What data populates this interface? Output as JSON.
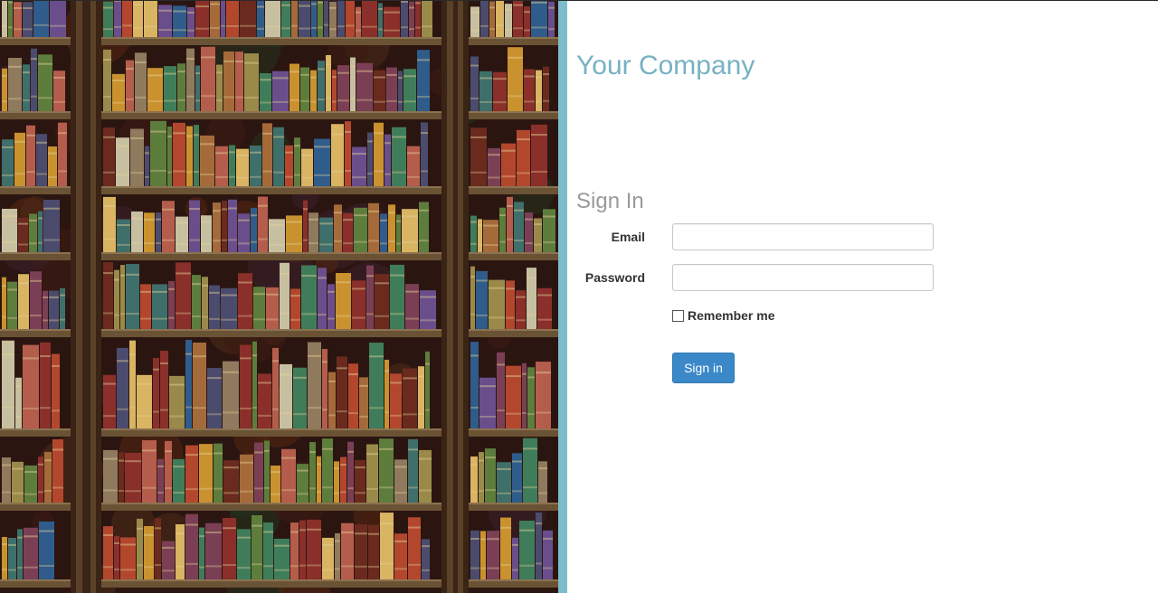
{
  "brand": {
    "company_name": "Your Company"
  },
  "signin": {
    "title": "Sign In",
    "email_label": "Email",
    "email_value": "",
    "password_label": "Password",
    "password_value": "",
    "remember_label": "Remember me",
    "remember_checked": false,
    "submit_label": "Sign in"
  },
  "colors": {
    "accent_bar": "#7dbdcb",
    "company_text": "#77b1c4",
    "button_bg": "#3a88c8",
    "heading_text": "#9a9a9a"
  },
  "icons": {
    "remember_checkbox": "checkbox-unchecked-icon"
  }
}
